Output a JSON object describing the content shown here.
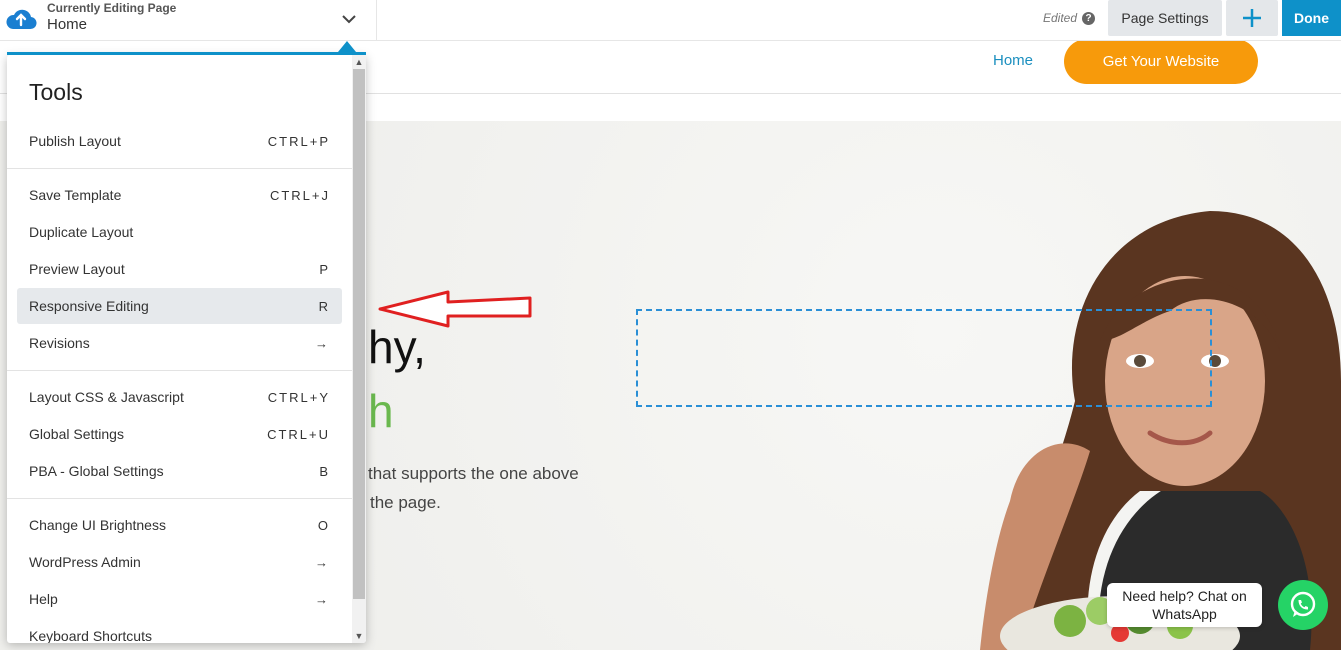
{
  "topbar": {
    "editing_label": "Currently Editing Page",
    "editing_page": "Home",
    "status": "Edited",
    "page_settings_label": "Page Settings",
    "add_icon": "plus-icon",
    "done_label": "Done"
  },
  "site_header": {
    "nav_home": "Home",
    "cta_label": "Get Your Website"
  },
  "hero": {
    "title_line1": "hy,",
    "title_line2": "h",
    "text_line1": "that supports the one above",
    "text_line2": "the page."
  },
  "menu": {
    "title": "Tools",
    "items": [
      {
        "label": "Publish Layout",
        "shortcut": "CTRL+P"
      },
      {
        "label": "Save Template",
        "shortcut": "CTRL+J"
      },
      {
        "label": "Duplicate Layout",
        "shortcut": ""
      },
      {
        "label": "Preview Layout",
        "shortcut": "P"
      },
      {
        "label": "Responsive Editing",
        "shortcut": "R"
      },
      {
        "label": "Revisions",
        "shortcut": "→"
      },
      {
        "label": "Layout CSS & Javascript",
        "shortcut": "CTRL+Y"
      },
      {
        "label": "Global Settings",
        "shortcut": "CTRL+U"
      },
      {
        "label": "PBA - Global Settings",
        "shortcut": "B"
      },
      {
        "label": "Change UI Brightness",
        "shortcut": "O"
      },
      {
        "label": "WordPress Admin",
        "shortcut": "→"
      },
      {
        "label": "Help",
        "shortcut": "→"
      },
      {
        "label": "Keyboard Shortcuts",
        "shortcut": ""
      }
    ],
    "active_item": "Responsive Editing"
  },
  "whatsapp": {
    "bubble_line1": "Need help? Chat on",
    "bubble_line2": "WhatsApp"
  },
  "colors": {
    "accent_blue": "#0e91c9",
    "cta_orange": "#f79a0b",
    "hero_green": "#6ab84e",
    "annotation_red": "#e02020",
    "whatsapp_green": "#25d366"
  }
}
